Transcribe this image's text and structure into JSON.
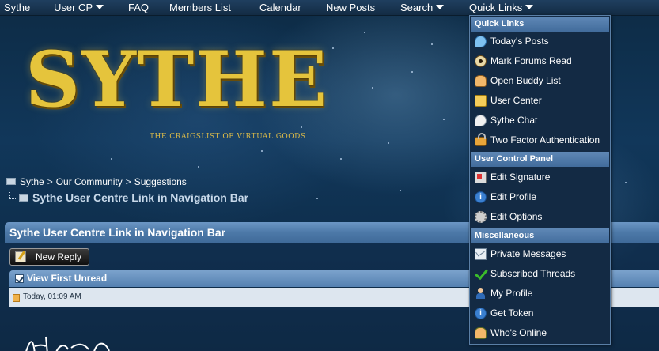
{
  "navbar": {
    "items": [
      {
        "label": "Sythe",
        "caret": false
      },
      {
        "label": "User CP",
        "caret": true
      },
      {
        "label": "FAQ",
        "caret": false
      },
      {
        "label": "Members List",
        "caret": false
      },
      {
        "label": "Calendar",
        "caret": false
      },
      {
        "label": "New Posts",
        "caret": false
      },
      {
        "label": "Search",
        "caret": true
      },
      {
        "label": "Quick Links",
        "caret": true
      }
    ]
  },
  "logo": {
    "text": "SYTHE",
    "tagline": "THE CRAIGSLIST OF VIRTUAL GOODS"
  },
  "breadcrumb": {
    "items": [
      "Sythe",
      "Our Community",
      "Suggestions"
    ],
    "separator": ">",
    "current": "Sythe User Centre Link in Navigation Bar"
  },
  "thread": {
    "title": "Sythe User Centre Link in Navigation Bar",
    "new_reply_label": "New Reply",
    "view_first_unread": "View First Unread",
    "post_date": "Today, 01:09 AM"
  },
  "quick_links": {
    "sections": [
      {
        "title": "Quick Links",
        "items": [
          {
            "label": "Today's Posts",
            "icon": "speech-bubble-icon"
          },
          {
            "label": "Mark Forums Read",
            "icon": "eye-icon"
          },
          {
            "label": "Open Buddy List",
            "icon": "buddy-list-icon"
          },
          {
            "label": "User Center",
            "icon": "folder-icon"
          },
          {
            "label": "Sythe Chat",
            "icon": "chat-icon"
          },
          {
            "label": "Two Factor Authentication",
            "icon": "lock-icon"
          }
        ]
      },
      {
        "title": "User Control Panel",
        "items": [
          {
            "label": "Edit Signature",
            "icon": "signature-icon"
          },
          {
            "label": "Edit Profile",
            "icon": "info-icon"
          },
          {
            "label": "Edit Options",
            "icon": "gear-icon"
          }
        ]
      },
      {
        "title": "Miscellaneous",
        "items": [
          {
            "label": "Private Messages",
            "icon": "mail-icon"
          },
          {
            "label": "Subscribed Threads",
            "icon": "checkmark-icon"
          },
          {
            "label": "My Profile",
            "icon": "person-icon"
          },
          {
            "label": "Get Token",
            "icon": "info-icon"
          },
          {
            "label": "Who's Online",
            "icon": "group-icon"
          }
        ]
      }
    ]
  },
  "colors": {
    "navbar": "#132c44",
    "section_header": "#4d79a8",
    "menu_bg": "#132a44",
    "logo_gold": "#e5c43c"
  }
}
